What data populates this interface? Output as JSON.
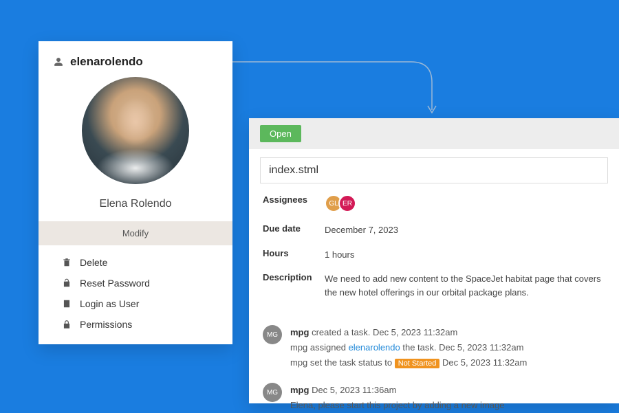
{
  "profile": {
    "username": "elenarolendo",
    "full_name": "Elena Rolendo",
    "modify_label": "Modify",
    "actions": {
      "delete": "Delete",
      "reset_password": "Reset Password",
      "login_as": "Login as User",
      "permissions": "Permissions"
    }
  },
  "task": {
    "status": "Open",
    "title": "index.stml",
    "labels": {
      "assignees": "Assignees",
      "due_date": "Due date",
      "hours": "Hours",
      "description": "Description"
    },
    "assignees": [
      {
        "initials": "GL",
        "color": "#e09e4a"
      },
      {
        "initials": "ER",
        "color": "#d31a56"
      }
    ],
    "due_date": "December 7, 2023",
    "hours": "1 hours",
    "description": "We need to add new content to the SpaceJet habitat page that covers the new hotel offerings in our orbital package plans."
  },
  "activity": [
    {
      "avatar": "MG",
      "lines": [
        {
          "author": "mpg",
          "text": " created a task. Dec 5, 2023 11:32am"
        },
        {
          "plain_before": "mpg assigned ",
          "link": "elenarolendo",
          "plain_after": " the task. Dec 5, 2023 11:32am"
        },
        {
          "plain_before": "mpg set the task status to ",
          "tag": "Not Started",
          "plain_after": " Dec 5, 2023 11:32am"
        }
      ]
    },
    {
      "avatar": "MG",
      "lines": [
        {
          "author": "mpg",
          "text": " Dec 5, 2023 11:36am"
        },
        {
          "plain_before": "Elena, please start this project by adding a new image"
        }
      ]
    }
  ]
}
